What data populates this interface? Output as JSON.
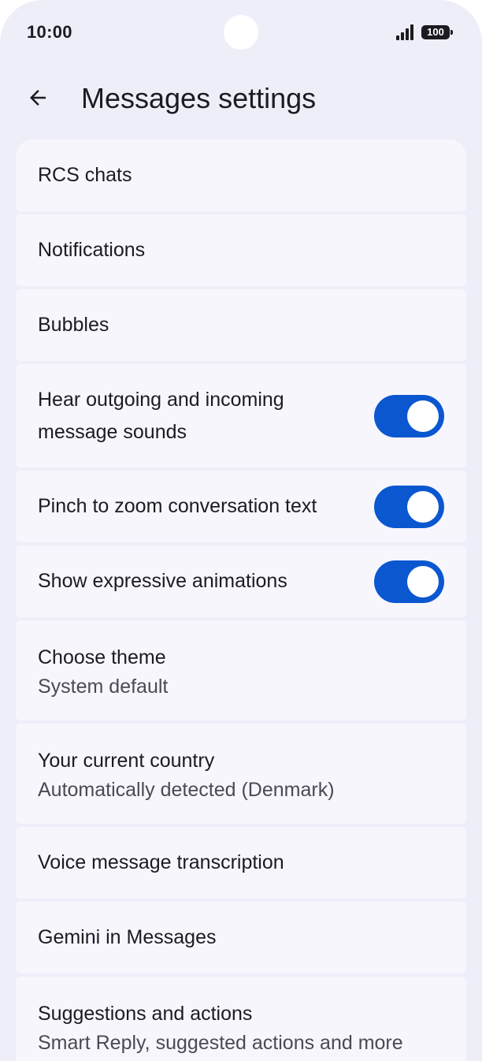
{
  "status_bar": {
    "time": "10:00",
    "battery": "100",
    "icons": [
      "signal-icon",
      "battery-icon"
    ]
  },
  "header": {
    "back_icon": "arrow-back-icon",
    "title": "Messages settings"
  },
  "colors": {
    "background": "#eeeef9",
    "row_background": "#f7f6fd",
    "toggle_on": "#0b57d0",
    "text_primary": "#1b1b21",
    "text_secondary": "#4a4a55"
  },
  "settings": [
    {
      "title": "RCS chats"
    },
    {
      "title": "Notifications"
    },
    {
      "title": "Bubbles"
    },
    {
      "title": "Hear outgoing and incoming message sounds",
      "toggle": true,
      "checked": true
    },
    {
      "title": "Pinch to zoom conversation text",
      "toggle": true,
      "checked": true
    },
    {
      "title": "Show expressive animations",
      "toggle": true,
      "checked": true
    },
    {
      "title": "Choose theme",
      "subtitle": "System default"
    },
    {
      "title": "Your current country",
      "subtitle": "Automatically detected (Denmark)"
    },
    {
      "title": "Voice message transcription"
    },
    {
      "title": "Gemini in Messages"
    },
    {
      "title": "Suggestions and actions",
      "subtitle": "Smart Reply, suggested actions and more"
    }
  ]
}
